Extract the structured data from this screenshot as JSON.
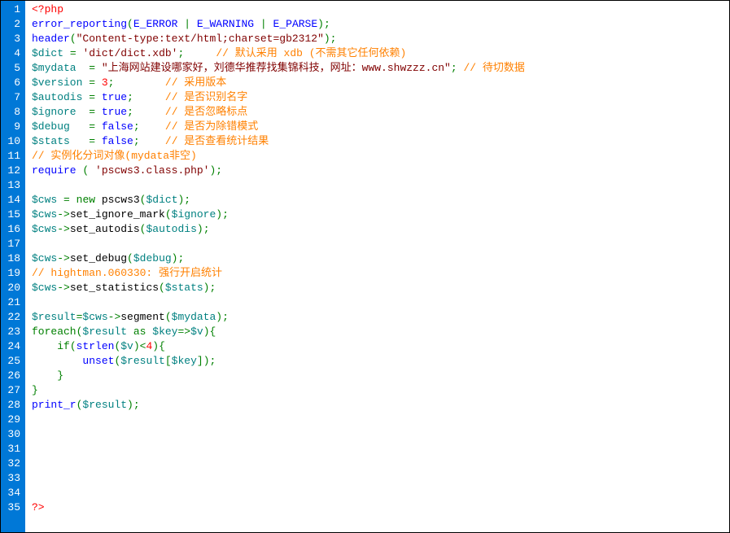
{
  "lines": [
    {
      "n": 1,
      "segs": [
        {
          "c": "t-red",
          "t": "<?php"
        }
      ]
    },
    {
      "n": 2,
      "segs": [
        {
          "c": "t-blue",
          "t": "error_reporting"
        },
        {
          "c": "t-green",
          "t": "("
        },
        {
          "c": "t-blue",
          "t": "E_ERROR"
        },
        {
          "c": "t-black",
          "t": " "
        },
        {
          "c": "t-green",
          "t": "|"
        },
        {
          "c": "t-black",
          "t": " "
        },
        {
          "c": "t-blue",
          "t": "E_WARNING"
        },
        {
          "c": "t-black",
          "t": " "
        },
        {
          "c": "t-green",
          "t": "|"
        },
        {
          "c": "t-black",
          "t": " "
        },
        {
          "c": "t-blue",
          "t": "E_PARSE"
        },
        {
          "c": "t-green",
          "t": ");"
        }
      ]
    },
    {
      "n": 3,
      "segs": [
        {
          "c": "t-blue",
          "t": "header"
        },
        {
          "c": "t-green",
          "t": "("
        },
        {
          "c": "t-wine",
          "t": "\"Content-type:text/html;charset=gb2312\""
        },
        {
          "c": "t-green",
          "t": ");"
        }
      ]
    },
    {
      "n": 4,
      "segs": [
        {
          "c": "t-teal",
          "t": "$dict"
        },
        {
          "c": "t-black",
          "t": " "
        },
        {
          "c": "t-green",
          "t": "="
        },
        {
          "c": "t-black",
          "t": " "
        },
        {
          "c": "t-wine",
          "t": "'dict/dict.xdb'"
        },
        {
          "c": "t-green",
          "t": ";"
        },
        {
          "c": "t-black",
          "t": "     "
        },
        {
          "c": "t-orange",
          "t": "// 默认采用 xdb (不需其它任何依赖)"
        }
      ]
    },
    {
      "n": 5,
      "segs": [
        {
          "c": "t-teal",
          "t": "$mydata"
        },
        {
          "c": "t-black",
          "t": "  "
        },
        {
          "c": "t-green",
          "t": "="
        },
        {
          "c": "t-black",
          "t": " "
        },
        {
          "c": "t-wine",
          "t": "\"上海网站建设哪家好，刘德华推荐找集锦科技，网址：www.shwzzz.cn\""
        },
        {
          "c": "t-green",
          "t": ";"
        },
        {
          "c": "t-black",
          "t": " "
        },
        {
          "c": "t-orange",
          "t": "// 待切数据"
        }
      ]
    },
    {
      "n": 6,
      "segs": [
        {
          "c": "t-teal",
          "t": "$version"
        },
        {
          "c": "t-black",
          "t": " "
        },
        {
          "c": "t-green",
          "t": "="
        },
        {
          "c": "t-black",
          "t": " "
        },
        {
          "c": "t-red",
          "t": "3"
        },
        {
          "c": "t-green",
          "t": ";"
        },
        {
          "c": "t-black",
          "t": "        "
        },
        {
          "c": "t-orange",
          "t": "// 采用版本"
        }
      ]
    },
    {
      "n": 7,
      "segs": [
        {
          "c": "t-teal",
          "t": "$autodis"
        },
        {
          "c": "t-black",
          "t": " "
        },
        {
          "c": "t-green",
          "t": "="
        },
        {
          "c": "t-black",
          "t": " "
        },
        {
          "c": "t-blue",
          "t": "true"
        },
        {
          "c": "t-green",
          "t": ";"
        },
        {
          "c": "t-black",
          "t": "     "
        },
        {
          "c": "t-orange",
          "t": "// 是否识别名字"
        }
      ]
    },
    {
      "n": 8,
      "segs": [
        {
          "c": "t-teal",
          "t": "$ignore"
        },
        {
          "c": "t-black",
          "t": "  "
        },
        {
          "c": "t-green",
          "t": "="
        },
        {
          "c": "t-black",
          "t": " "
        },
        {
          "c": "t-blue",
          "t": "true"
        },
        {
          "c": "t-green",
          "t": ";"
        },
        {
          "c": "t-black",
          "t": "     "
        },
        {
          "c": "t-orange",
          "t": "// 是否忽略标点"
        }
      ]
    },
    {
      "n": 9,
      "segs": [
        {
          "c": "t-teal",
          "t": "$debug"
        },
        {
          "c": "t-black",
          "t": "   "
        },
        {
          "c": "t-green",
          "t": "="
        },
        {
          "c": "t-black",
          "t": " "
        },
        {
          "c": "t-blue",
          "t": "false"
        },
        {
          "c": "t-green",
          "t": ";"
        },
        {
          "c": "t-black",
          "t": "    "
        },
        {
          "c": "t-orange",
          "t": "// 是否为除错模式"
        }
      ]
    },
    {
      "n": 10,
      "segs": [
        {
          "c": "t-teal",
          "t": "$stats"
        },
        {
          "c": "t-black",
          "t": "   "
        },
        {
          "c": "t-green",
          "t": "="
        },
        {
          "c": "t-black",
          "t": " "
        },
        {
          "c": "t-blue",
          "t": "false"
        },
        {
          "c": "t-green",
          "t": ";"
        },
        {
          "c": "t-black",
          "t": "    "
        },
        {
          "c": "t-orange",
          "t": "// 是否查看统计结果"
        }
      ]
    },
    {
      "n": 11,
      "segs": [
        {
          "c": "t-orange",
          "t": "// 实例化分词对像(mydata非空)"
        }
      ]
    },
    {
      "n": 12,
      "segs": [
        {
          "c": "t-blue",
          "t": "require"
        },
        {
          "c": "t-black",
          "t": " "
        },
        {
          "c": "t-green",
          "t": "("
        },
        {
          "c": "t-black",
          "t": " "
        },
        {
          "c": "t-wine",
          "t": "'pscws3.class.php'"
        },
        {
          "c": "t-green",
          "t": ");"
        }
      ]
    },
    {
      "n": 13,
      "segs": []
    },
    {
      "n": 14,
      "segs": [
        {
          "c": "t-teal",
          "t": "$cws"
        },
        {
          "c": "t-black",
          "t": " "
        },
        {
          "c": "t-green",
          "t": "="
        },
        {
          "c": "t-black",
          "t": " "
        },
        {
          "c": "t-green",
          "t": "new"
        },
        {
          "c": "t-black",
          "t": " pscws3"
        },
        {
          "c": "t-green",
          "t": "("
        },
        {
          "c": "t-teal",
          "t": "$dict"
        },
        {
          "c": "t-green",
          "t": ");"
        }
      ]
    },
    {
      "n": 15,
      "segs": [
        {
          "c": "t-teal",
          "t": "$cws"
        },
        {
          "c": "t-green",
          "t": "->"
        },
        {
          "c": "t-black",
          "t": "set_ignore_mark"
        },
        {
          "c": "t-green",
          "t": "("
        },
        {
          "c": "t-teal",
          "t": "$ignore"
        },
        {
          "c": "t-green",
          "t": ");"
        }
      ]
    },
    {
      "n": 16,
      "segs": [
        {
          "c": "t-teal",
          "t": "$cws"
        },
        {
          "c": "t-green",
          "t": "->"
        },
        {
          "c": "t-black",
          "t": "set_autodis"
        },
        {
          "c": "t-green",
          "t": "("
        },
        {
          "c": "t-teal",
          "t": "$autodis"
        },
        {
          "c": "t-green",
          "t": ");"
        }
      ]
    },
    {
      "n": 17,
      "segs": []
    },
    {
      "n": 18,
      "segs": [
        {
          "c": "t-teal",
          "t": "$cws"
        },
        {
          "c": "t-green",
          "t": "->"
        },
        {
          "c": "t-black",
          "t": "set_debug"
        },
        {
          "c": "t-green",
          "t": "("
        },
        {
          "c": "t-teal",
          "t": "$debug"
        },
        {
          "c": "t-green",
          "t": ");"
        }
      ]
    },
    {
      "n": 19,
      "segs": [
        {
          "c": "t-orange",
          "t": "// hightman.060330: 强行开启统计"
        }
      ]
    },
    {
      "n": 20,
      "segs": [
        {
          "c": "t-teal",
          "t": "$cws"
        },
        {
          "c": "t-green",
          "t": "->"
        },
        {
          "c": "t-black",
          "t": "set_statistics"
        },
        {
          "c": "t-green",
          "t": "("
        },
        {
          "c": "t-teal",
          "t": "$stats"
        },
        {
          "c": "t-green",
          "t": ");"
        }
      ]
    },
    {
      "n": 21,
      "segs": []
    },
    {
      "n": 22,
      "segs": [
        {
          "c": "t-teal",
          "t": "$result"
        },
        {
          "c": "t-green",
          "t": "="
        },
        {
          "c": "t-teal",
          "t": "$cws"
        },
        {
          "c": "t-green",
          "t": "->"
        },
        {
          "c": "t-black",
          "t": "segment"
        },
        {
          "c": "t-green",
          "t": "("
        },
        {
          "c": "t-teal",
          "t": "$mydata"
        },
        {
          "c": "t-green",
          "t": ");"
        }
      ]
    },
    {
      "n": 23,
      "segs": [
        {
          "c": "t-green",
          "t": "foreach("
        },
        {
          "c": "t-teal",
          "t": "$result"
        },
        {
          "c": "t-black",
          "t": " "
        },
        {
          "c": "t-green",
          "t": "as"
        },
        {
          "c": "t-black",
          "t": " "
        },
        {
          "c": "t-teal",
          "t": "$key"
        },
        {
          "c": "t-green",
          "t": "=>"
        },
        {
          "c": "t-teal",
          "t": "$v"
        },
        {
          "c": "t-green",
          "t": "){"
        }
      ]
    },
    {
      "n": 24,
      "segs": [
        {
          "c": "t-black",
          "t": "    "
        },
        {
          "c": "t-green",
          "t": "if("
        },
        {
          "c": "t-blue",
          "t": "strlen"
        },
        {
          "c": "t-green",
          "t": "("
        },
        {
          "c": "t-teal",
          "t": "$v"
        },
        {
          "c": "t-green",
          "t": ")<"
        },
        {
          "c": "t-red",
          "t": "4"
        },
        {
          "c": "t-green",
          "t": "){"
        }
      ]
    },
    {
      "n": 25,
      "segs": [
        {
          "c": "t-black",
          "t": "        "
        },
        {
          "c": "t-blue",
          "t": "unset"
        },
        {
          "c": "t-green",
          "t": "("
        },
        {
          "c": "t-teal",
          "t": "$result"
        },
        {
          "c": "t-green",
          "t": "["
        },
        {
          "c": "t-teal",
          "t": "$key"
        },
        {
          "c": "t-green",
          "t": "]);"
        }
      ]
    },
    {
      "n": 26,
      "segs": [
        {
          "c": "t-black",
          "t": "    "
        },
        {
          "c": "t-green",
          "t": "}"
        }
      ]
    },
    {
      "n": 27,
      "segs": [
        {
          "c": "t-green",
          "t": "}"
        }
      ]
    },
    {
      "n": 28,
      "segs": [
        {
          "c": "t-blue",
          "t": "print_r"
        },
        {
          "c": "t-green",
          "t": "("
        },
        {
          "c": "t-teal",
          "t": "$result"
        },
        {
          "c": "t-green",
          "t": ");"
        }
      ]
    },
    {
      "n": 29,
      "segs": []
    },
    {
      "n": 30,
      "segs": []
    },
    {
      "n": 31,
      "segs": []
    },
    {
      "n": 32,
      "segs": []
    },
    {
      "n": 33,
      "segs": []
    },
    {
      "n": 34,
      "segs": []
    },
    {
      "n": 35,
      "segs": [
        {
          "c": "t-red",
          "t": "?>"
        }
      ]
    }
  ]
}
